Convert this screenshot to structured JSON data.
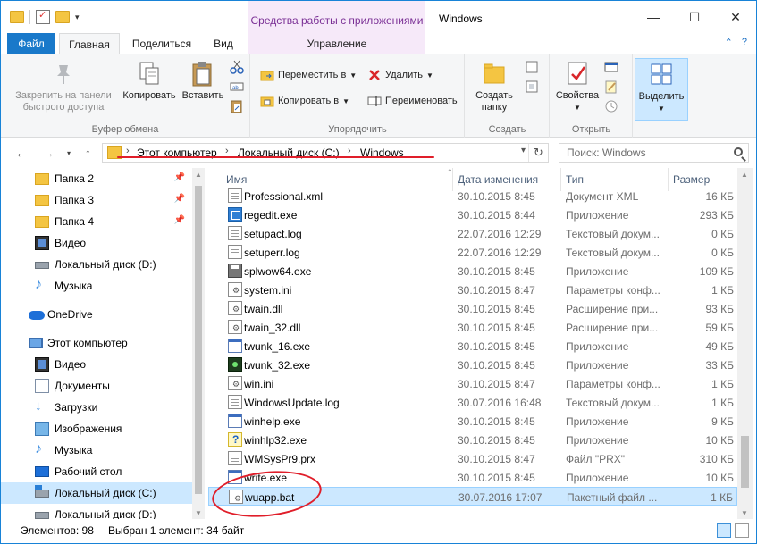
{
  "window": {
    "title": "Windows",
    "context_tab_header": "Средства работы с приложениями"
  },
  "ribbon_tabs": {
    "file": "Файл",
    "home": "Главная",
    "share": "Поделиться",
    "view": "Вид",
    "manage": "Управление"
  },
  "ribbon": {
    "clipboard": {
      "label": "Буфер обмена",
      "pin": "Закрепить на панели быстрого доступа",
      "pin_line1": "Закрепить на панели",
      "pin_line2": "быстрого доступа",
      "copy": "Копировать",
      "paste": "Вставить"
    },
    "organize": {
      "label": "Упорядочить",
      "move_to": "Переместить в",
      "copy_to": "Копировать в",
      "delete": "Удалить",
      "rename": "Переименовать"
    },
    "create": {
      "label": "Создать",
      "new_folder_line1": "Создать",
      "new_folder_line2": "папку"
    },
    "open": {
      "label": "Открыть",
      "properties": "Свойства"
    },
    "select": {
      "label": "Выделить"
    }
  },
  "address": {
    "crumbs": [
      "Этот компьютер",
      "Локальный диск (C:)",
      "Windows"
    ],
    "search_placeholder": "Поиск: Windows"
  },
  "nav": {
    "items": [
      {
        "label": "Папка 2",
        "icon": "folder-icon",
        "pinned": true
      },
      {
        "label": "Папка 3",
        "icon": "folder-icon",
        "pinned": true
      },
      {
        "label": "Папка 4",
        "icon": "folder-icon",
        "pinned": true
      },
      {
        "label": "Видео",
        "icon": "video-icon"
      },
      {
        "label": "Локальный диск (D:)",
        "icon": "drive-icon"
      },
      {
        "label": "Музыка",
        "icon": "music-icon"
      },
      {
        "label": "OneDrive",
        "icon": "cloud-icon"
      },
      {
        "label": "Этот компьютер",
        "icon": "computer-icon"
      },
      {
        "label": "Видео",
        "icon": "video-icon"
      },
      {
        "label": "Документы",
        "icon": "documents-icon"
      },
      {
        "label": "Загрузки",
        "icon": "downloads-icon"
      },
      {
        "label": "Изображения",
        "icon": "pictures-icon"
      },
      {
        "label": "Музыка",
        "icon": "music-icon"
      },
      {
        "label": "Рабочий стол",
        "icon": "desktop-icon"
      },
      {
        "label": "Локальный диск (C:)",
        "icon": "system-drive-icon",
        "selected": true
      },
      {
        "label": "Локальный диск (D:)",
        "icon": "drive-icon"
      }
    ]
  },
  "columns": {
    "name": "Имя",
    "date": "Дата изменения",
    "type": "Тип",
    "size": "Размер"
  },
  "files": [
    {
      "name": "Professional.xml",
      "date": "30.10.2015 8:45",
      "type": "Документ XML",
      "size": "16 КБ",
      "icon": "xml-file-icon"
    },
    {
      "name": "regedit.exe",
      "date": "30.10.2015 8:44",
      "type": "Приложение",
      "size": "293 КБ",
      "icon": "regedit-icon"
    },
    {
      "name": "setupact.log",
      "date": "22.07.2016 12:29",
      "type": "Текстовый докум...",
      "size": "0 КБ",
      "icon": "text-file-icon"
    },
    {
      "name": "setuperr.log",
      "date": "22.07.2016 12:29",
      "type": "Текстовый докум...",
      "size": "0 КБ",
      "icon": "text-file-icon"
    },
    {
      "name": "splwow64.exe",
      "date": "30.10.2015 8:45",
      "type": "Приложение",
      "size": "109 КБ",
      "icon": "printer-icon"
    },
    {
      "name": "system.ini",
      "date": "30.10.2015 8:47",
      "type": "Параметры конф...",
      "size": "1 КБ",
      "icon": "ini-file-icon"
    },
    {
      "name": "twain.dll",
      "date": "30.10.2015 8:45",
      "type": "Расширение при...",
      "size": "93 КБ",
      "icon": "dll-file-icon"
    },
    {
      "name": "twain_32.dll",
      "date": "30.10.2015 8:45",
      "type": "Расширение при...",
      "size": "59 КБ",
      "icon": "dll-file-icon"
    },
    {
      "name": "twunk_16.exe",
      "date": "30.10.2015 8:45",
      "type": "Приложение",
      "size": "49 КБ",
      "icon": "exe-file-icon"
    },
    {
      "name": "twunk_32.exe",
      "date": "30.10.2015 8:45",
      "type": "Приложение",
      "size": "33 КБ",
      "icon": "scanner-app-icon"
    },
    {
      "name": "win.ini",
      "date": "30.10.2015 8:47",
      "type": "Параметры конф...",
      "size": "1 КБ",
      "icon": "ini-file-icon"
    },
    {
      "name": "WindowsUpdate.log",
      "date": "30.07.2016 16:48",
      "type": "Текстовый докум...",
      "size": "1 КБ",
      "icon": "text-file-icon"
    },
    {
      "name": "winhelp.exe",
      "date": "30.10.2015 8:45",
      "type": "Приложение",
      "size": "9 КБ",
      "icon": "exe-file-icon"
    },
    {
      "name": "winhlp32.exe",
      "date": "30.10.2015 8:45",
      "type": "Приложение",
      "size": "10 КБ",
      "icon": "help-icon"
    },
    {
      "name": "WMSysPr9.prx",
      "date": "30.10.2015 8:47",
      "type": "Файл \"PRX\"",
      "size": "310 КБ",
      "icon": "prx-file-icon"
    },
    {
      "name": "write.exe",
      "date": "30.10.2015 8:45",
      "type": "Приложение",
      "size": "10 КБ",
      "icon": "exe-file-icon"
    },
    {
      "name": "wuapp.bat",
      "date": "30.07.2016 17:07",
      "type": "Пакетный файл ...",
      "size": "1 КБ",
      "icon": "batch-file-icon",
      "selected": true
    }
  ],
  "status": {
    "count": "Элементов: 98",
    "selection": "Выбран 1 элемент: 34 байт"
  },
  "annotation_color": "#e01e2a",
  "accent": "#1979ca"
}
